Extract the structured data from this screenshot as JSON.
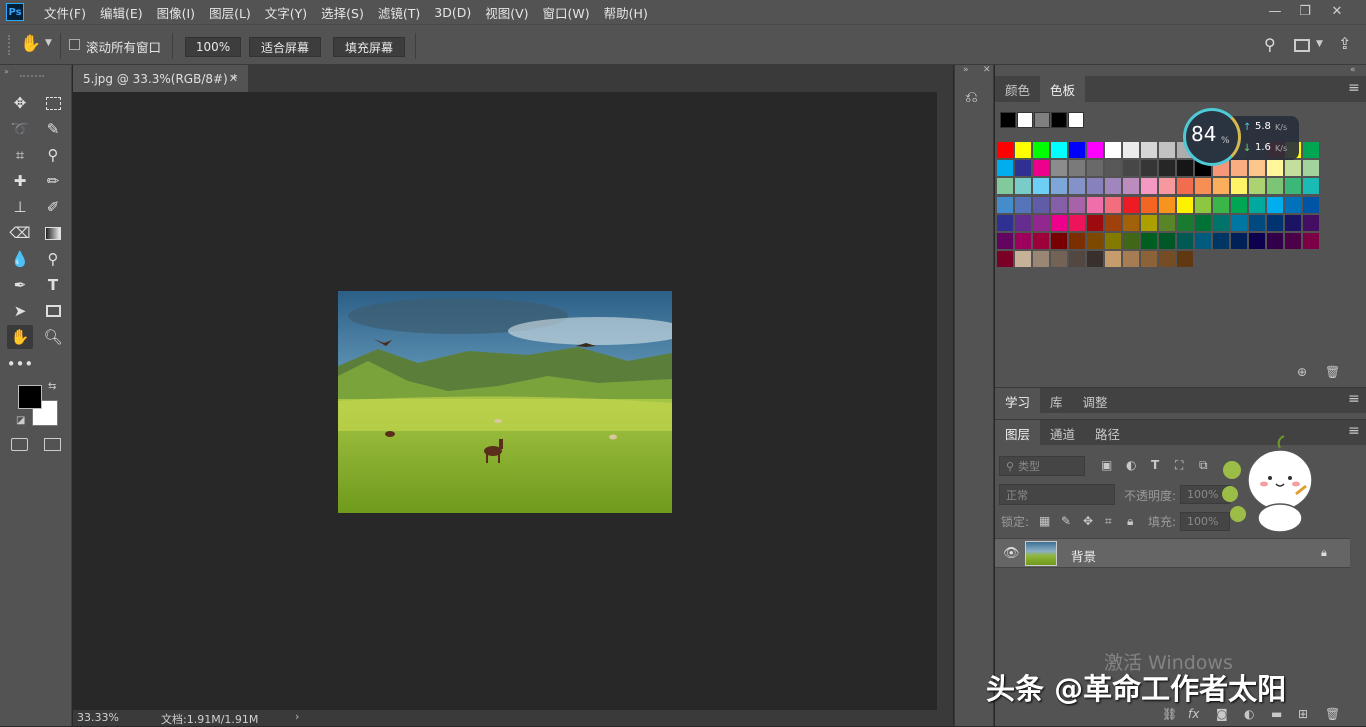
{
  "app": {
    "logo": "Ps"
  },
  "menu": [
    "文件(F)",
    "编辑(E)",
    "图像(I)",
    "图层(L)",
    "文字(Y)",
    "选择(S)",
    "滤镜(T)",
    "3D(D)",
    "视图(V)",
    "窗口(W)",
    "帮助(H)"
  ],
  "options": {
    "scroll_all_label": "滚动所有窗口",
    "zoom_value": "100%",
    "fit_screen": "适合屏幕",
    "fill_screen": "填充屏幕"
  },
  "document": {
    "tab_title": "5.jpg @ 33.3%(RGB/8#) *",
    "zoom_status": "33.33%",
    "doc_info": "文档:1.91M/1.91M"
  },
  "swatches_panel": {
    "tabs": [
      "颜色",
      "色板"
    ],
    "recent": [
      "#000000",
      "#ffffff",
      "#808080",
      "#000000",
      "#ffffff"
    ],
    "rows": [
      [
        "#ff0000",
        "#ffff00",
        "#00ff00",
        "#00ffff",
        "#0000ff",
        "#ff00ff",
        "#ffffff",
        "#ebebeb",
        "#d6d6d6",
        "#c2c2c2",
        "#adadad",
        "#999999",
        "#858585",
        "#707070",
        "#5c5c5c",
        "#ff0000",
        "#ffff00",
        "#00a651"
      ],
      [
        "#00aeef",
        "#2e3192",
        "#ec008c",
        "#8c8c8c",
        "#7a7a7a",
        "#696969",
        "#585858",
        "#474747",
        "#363636",
        "#262626",
        "#161616",
        "#000000",
        "#f7977a",
        "#fbad82",
        "#fdc68c",
        "#fff79a",
        "#c4df9b",
        "#a3d39c"
      ],
      [
        "#82ca9c",
        "#7accc8",
        "#6dcff6",
        "#7da7d9",
        "#8393ca",
        "#8781bd",
        "#a186be",
        "#bd8cbf",
        "#f49ac2",
        "#f6989d",
        "#f26c4f",
        "#f68e55",
        "#fbaf5c",
        "#fff467",
        "#acd372",
        "#7cc576",
        "#3bb878",
        "#1abbb4"
      ],
      [
        "#448ccb",
        "#5674b9",
        "#605ca8",
        "#855fa8",
        "#a763a8",
        "#f06eaa",
        "#f26d7d",
        "#ed1c24",
        "#f26522",
        "#f7941d",
        "#fff200",
        "#8dc63f",
        "#39b54a",
        "#00a651",
        "#00a99d",
        "#00aeef",
        "#0072bc",
        "#0054a6"
      ],
      [
        "#2e3192",
        "#662d91",
        "#92278f",
        "#ec008c",
        "#ed145b",
        "#9e0b0f",
        "#a0410d",
        "#a36209",
        "#aba000",
        "#598527",
        "#197b30",
        "#007236",
        "#00746b",
        "#0076a3",
        "#004a80",
        "#003471",
        "#1b1464",
        "#440e62"
      ],
      [
        "#630460",
        "#9e005d",
        "#9e0039",
        "#790000",
        "#7b2e00",
        "#7d4900",
        "#827b00",
        "#406618",
        "#005e20",
        "#005826",
        "#005952",
        "#005b7f",
        "#003663",
        "#002157",
        "#0d004c",
        "#32004b",
        "#4b0049",
        "#7b0046"
      ],
      [
        "#7a0026",
        "#c7b299",
        "#998675",
        "#736357",
        "#534741",
        "#37302d",
        "#c69c6d",
        "#a67c52",
        "#8c6239",
        "#754c24",
        "#603913"
      ]
    ]
  },
  "learn_tabs": [
    "学习",
    "库",
    "调整"
  ],
  "layers_panel": {
    "tabs": [
      "图层",
      "通道",
      "路径"
    ],
    "filter_placeholder": "类型",
    "blend_mode": "正常",
    "opacity_label": "不透明度:",
    "opacity_value": "100%",
    "lock_label": "锁定:",
    "fill_label": "填充:",
    "fill_value": "100%",
    "layers": [
      {
        "name": "背景",
        "visible": true,
        "locked": true
      }
    ]
  },
  "net_widget": {
    "percent": "84",
    "unit": "%",
    "up": "5.8",
    "down": "1.6",
    "rate_unit": "K/s"
  },
  "watermark": {
    "windows": "激活 Windows",
    "credit": "头条 @革命工作者太阳"
  },
  "colors": {
    "fg": "#000000",
    "bg": "#ffffff"
  }
}
